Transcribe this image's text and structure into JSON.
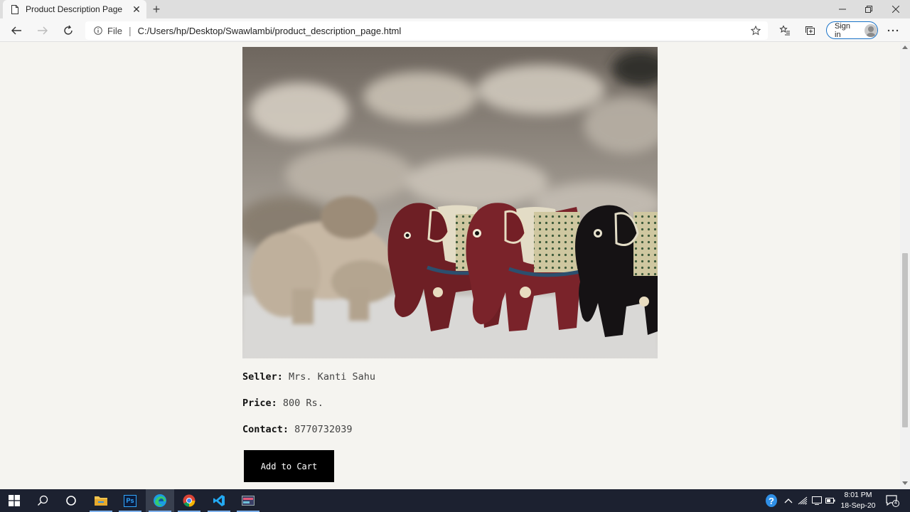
{
  "browser": {
    "tab_title": "Product Description Page",
    "address_scheme": "File",
    "url": "C:/Users/hp/Desktop/Swawlambi/product_description_page.html",
    "signin_label": "Sign in"
  },
  "product": {
    "image_alt": "Carved wooden elephant figurines",
    "seller_label": "Seller:",
    "seller_value": "Mrs. Kanti Sahu",
    "price_label": "Price:",
    "price_value": "800 Rs.",
    "contact_label": "Contact:",
    "contact_value": "8770732039",
    "cart_button": "Add to Cart"
  },
  "taskbar": {
    "icons": [
      "windows-start-icon",
      "search-icon",
      "cortana-icon",
      "file-explorer-icon",
      "photoshop-icon",
      "edge-icon",
      "chrome-icon",
      "vscode-icon",
      "app-icon"
    ],
    "photoshop_label": "Ps",
    "time": "8:01 PM",
    "date": "18-Sep-20",
    "notification_count": "4"
  }
}
